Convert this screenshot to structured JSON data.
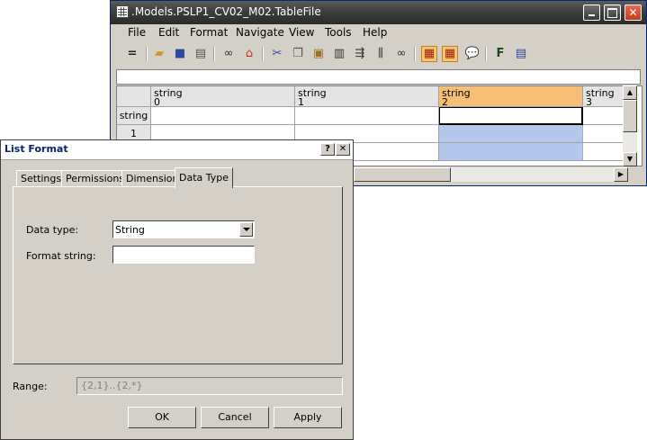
{
  "main_window": {
    "title": ".Models.PSLP1_CV02_M02.TableFile",
    "menu": [
      "File",
      "Edit",
      "Format",
      "Navigate",
      "View",
      "Tools",
      "Help"
    ],
    "toolbar_icons": [
      "equals-icon",
      "open-folder-icon",
      "save-icon",
      "print-icon",
      "binoculars-icon",
      "home-icon",
      "cut-icon",
      "copy-icon",
      "paste-icon",
      "delete-icon",
      "insert-row-icon",
      "insert-column-icon",
      "find-icon",
      "row-view-icon",
      "column-view-icon",
      "comment-icon",
      "format-icon",
      "grid-format-icon"
    ],
    "toolbar_equals_glyph": "=",
    "formula_value": "",
    "grid": {
      "columns": [
        {
          "type": "string",
          "index": "0"
        },
        {
          "type": "string",
          "index": "1"
        },
        {
          "type": "string",
          "index": "2"
        },
        {
          "type": "string",
          "index": "3"
        }
      ],
      "rows": [
        "string",
        "1",
        "2"
      ],
      "selected_column": "2"
    }
  },
  "dialog": {
    "title": "List Format",
    "help_glyph": "?",
    "close_glyph": "✕",
    "tabs": [
      "Settings",
      "Permissions",
      "Dimension",
      "Data Type"
    ],
    "active_tab": "Data Type",
    "data_type_label": "Data type:",
    "data_type_value": "String",
    "format_string_label": "Format string:",
    "format_string_value": "",
    "range_label": "Range:",
    "range_value": "{2,1}..{2,*}",
    "buttons": {
      "ok": "OK",
      "cancel": "Cancel",
      "apply": "Apply"
    }
  }
}
